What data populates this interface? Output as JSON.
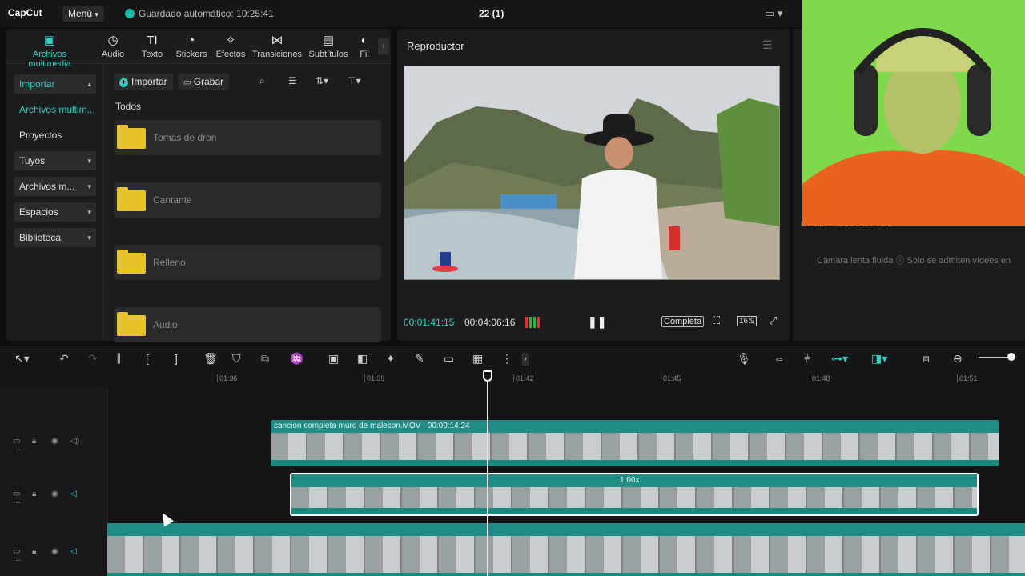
{
  "topbar": {
    "logo": "CapCut",
    "menu_label": "Menú",
    "autosave": "Guardado automático: 10:25:41",
    "project_title": "22 (1)"
  },
  "media_tabs": [
    {
      "label": "Archivos multimedia",
      "icon": "media-icon"
    },
    {
      "label": "Audio",
      "icon": "audio-icon"
    },
    {
      "label": "Texto",
      "icon": "text-icon"
    },
    {
      "label": "Stickers",
      "icon": "sticker-icon"
    },
    {
      "label": "Efectos",
      "icon": "effects-icon"
    },
    {
      "label": "Transiciones",
      "icon": "transitions-icon"
    },
    {
      "label": "Subtítulos",
      "icon": "subtitles-icon"
    },
    {
      "label": "Fil",
      "icon": "filters-icon"
    }
  ],
  "sidebar": [
    {
      "label": "Importar"
    },
    {
      "label": "Archivos multim..."
    },
    {
      "label": "Proyectos secun..."
    },
    {
      "label": "Tuyos"
    },
    {
      "label": "Archivos m..."
    },
    {
      "label": "Espacios"
    },
    {
      "label": "Biblioteca"
    }
  ],
  "media_toolbar": {
    "import_label": "Importar",
    "record_label": "Grabar"
  },
  "filter_label": "Todos",
  "folders": [
    {
      "name": "Tomas de dron"
    },
    {
      "name": "Cantante"
    },
    {
      "name": "Relleno"
    },
    {
      "name": "Audio"
    }
  ],
  "player": {
    "title": "Reproductor",
    "current_time": "00:01:41:15",
    "total_time": "00:04:06:16",
    "quality_label": "Completa",
    "ratio_label": "16:9"
  },
  "right_panel": {
    "text1": "Cambiar tono del audio",
    "text2": "Cámara lenta fluida  ⓘ Solo se admiten vídeos en"
  },
  "ruler_ticks": [
    "01:36",
    "01:39",
    "01:42",
    "01:45",
    "01:48",
    "01:51"
  ],
  "clips": {
    "main": {
      "name": "cancion completa muro de malecon.MOV",
      "duration": "00:00:14:24"
    },
    "speed": {
      "label": "1.00x"
    }
  },
  "colors": {
    "accent": "#2fd0c2",
    "clip": "#1f8c86",
    "folder": "#e8c22a"
  }
}
